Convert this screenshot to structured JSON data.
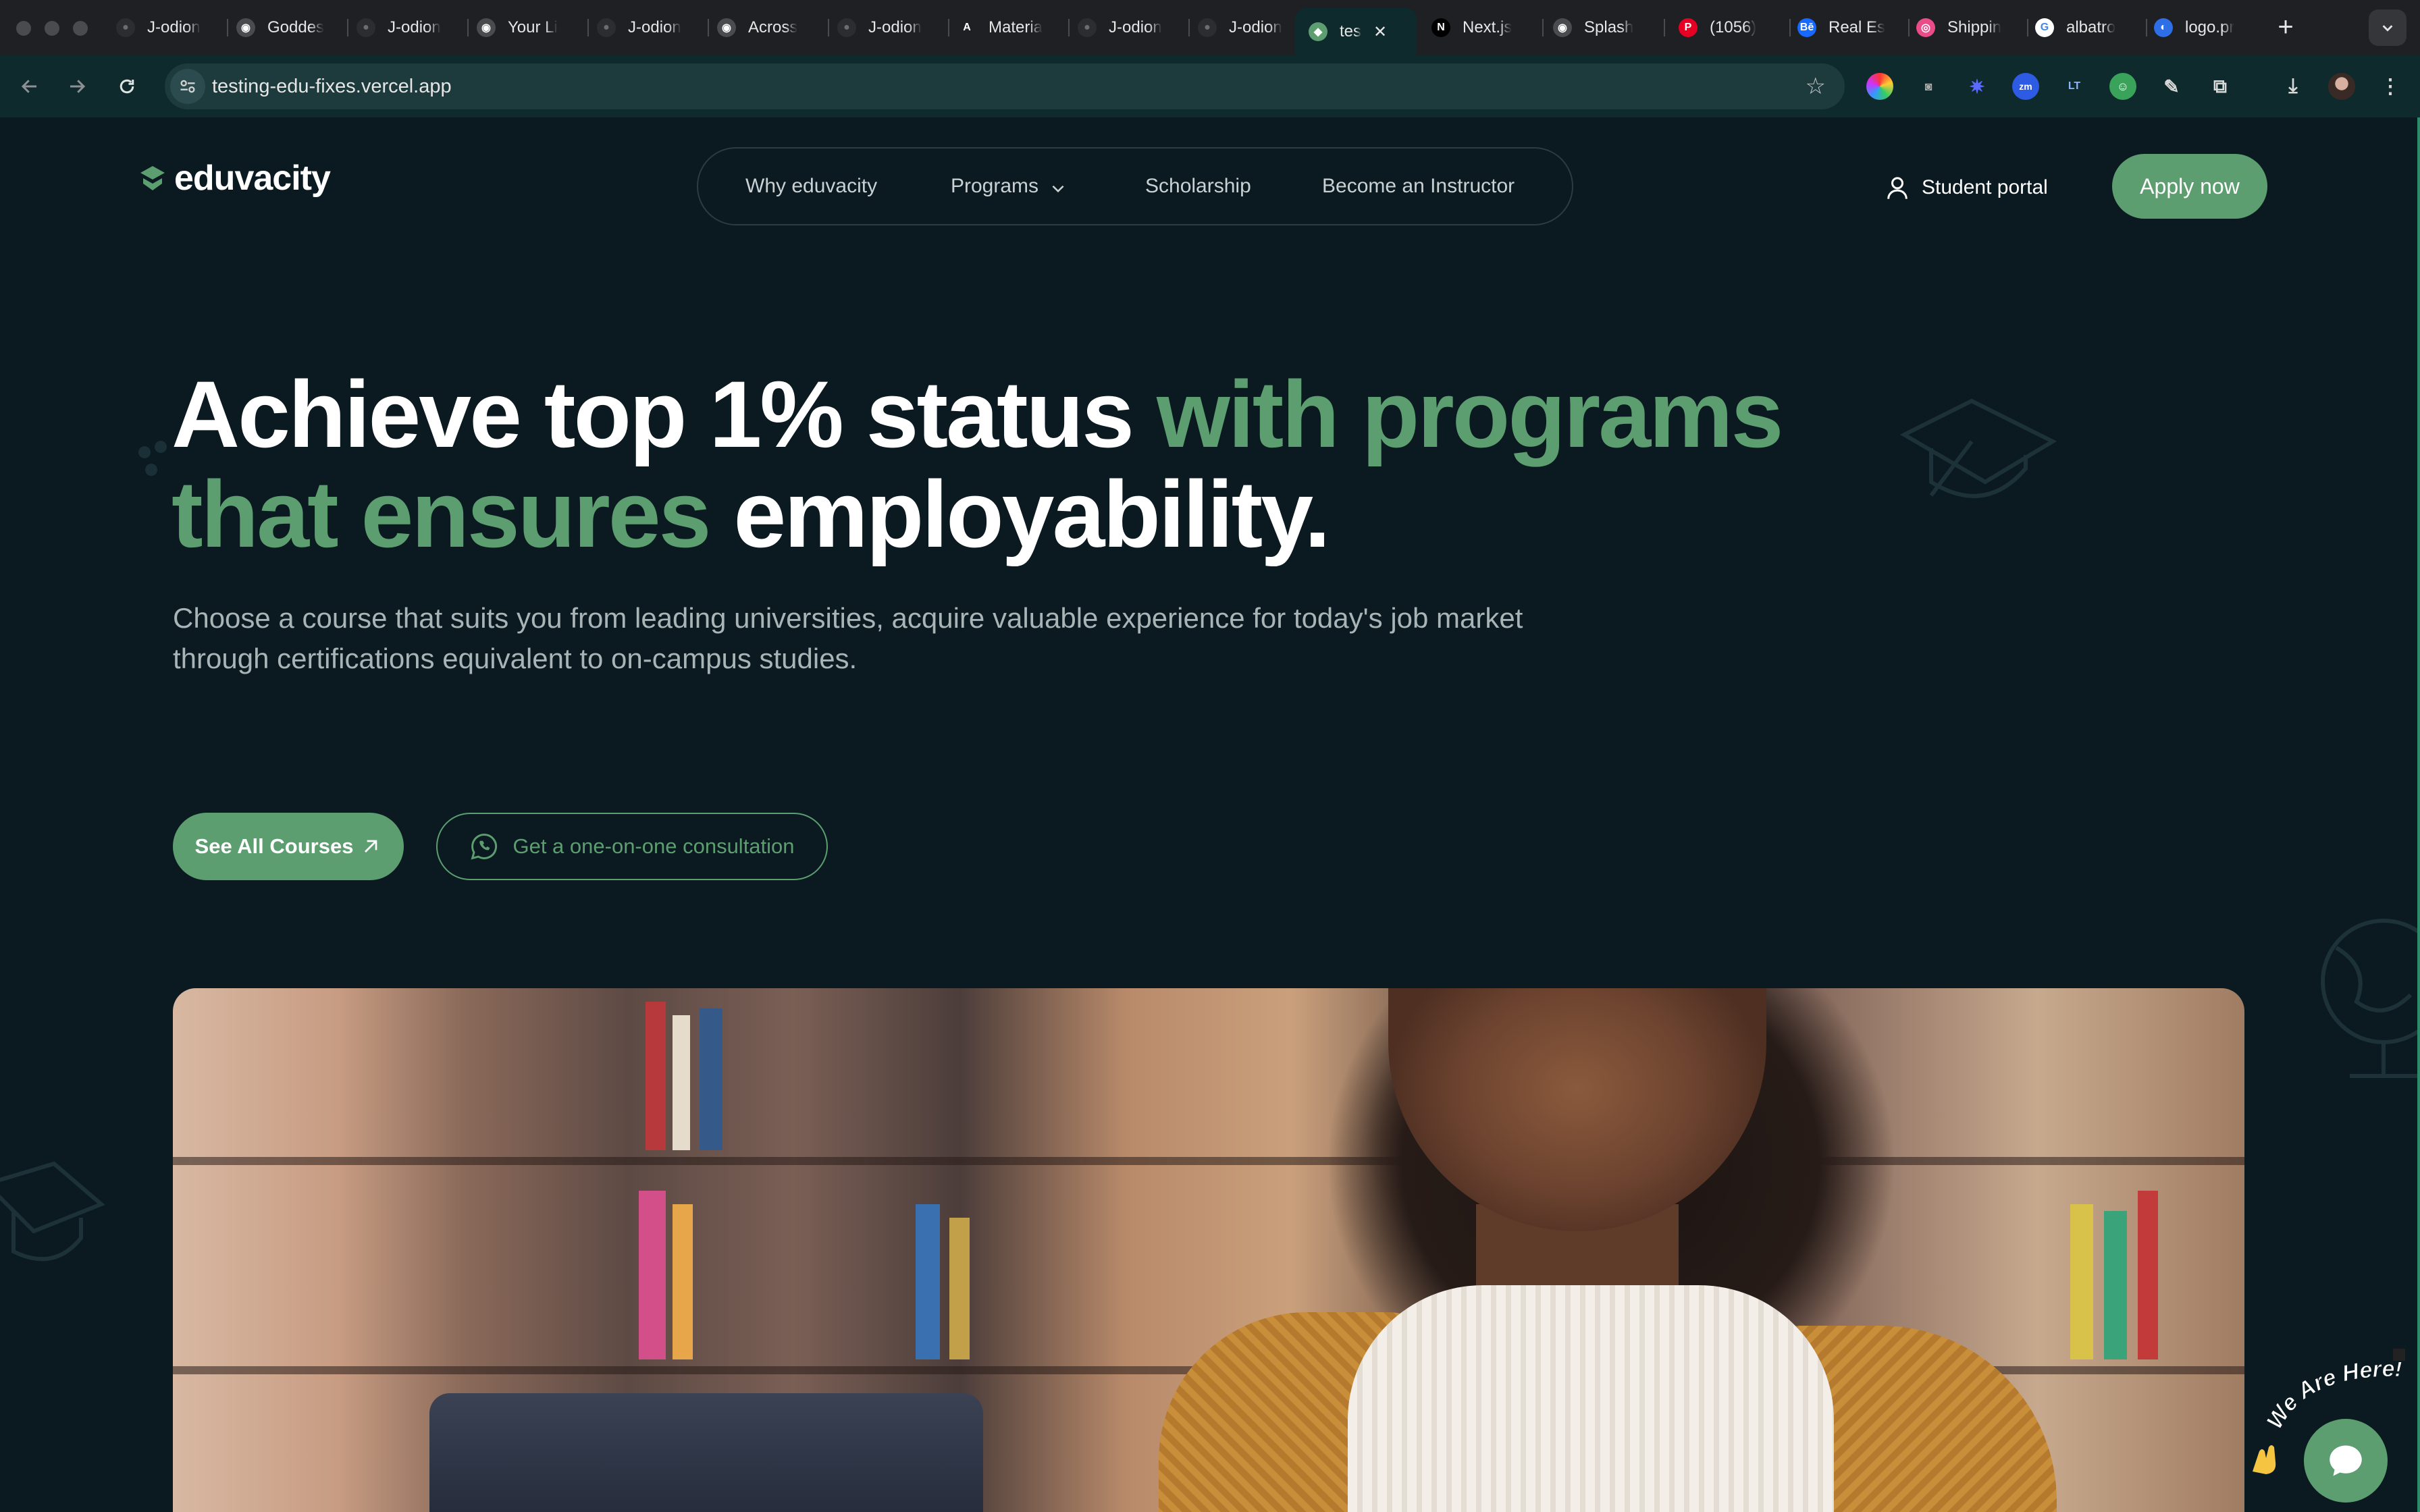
{
  "browser": {
    "tabs": [
      {
        "title": "J-odion",
        "icon": "github-icon",
        "color": "#2b2d31"
      },
      {
        "title": "Goddes",
        "icon": "globe-icon",
        "color": "#4a4b4e"
      },
      {
        "title": "J-odion",
        "icon": "github-icon",
        "color": "#2b2d31"
      },
      {
        "title": "Your Li",
        "icon": "globe-icon",
        "color": "#4a4b4e"
      },
      {
        "title": "J-odion",
        "icon": "github-icon",
        "color": "#2b2d31"
      },
      {
        "title": "Across",
        "icon": "globe-icon",
        "color": "#4a4b4e"
      },
      {
        "title": "J-odion",
        "icon": "github-icon",
        "color": "#2b2d31"
      },
      {
        "title": "Materia",
        "icon": "material-icon",
        "color": "#1f2023"
      },
      {
        "title": "J-odion",
        "icon": "github-icon",
        "color": "#2b2d31"
      },
      {
        "title": "J-odion",
        "icon": "github-icon",
        "color": "#2b2d31"
      },
      {
        "title": "tes",
        "icon": "eduvacity-icon",
        "color": "#5c9e70",
        "active": true
      },
      {
        "title": "Next.js",
        "icon": "nextjs-icon",
        "color": "#000000"
      },
      {
        "title": "Splash",
        "icon": "globe-icon",
        "color": "#4a4b4e"
      },
      {
        "title": "(1056)",
        "icon": "pinterest-icon",
        "color": "#e60023"
      },
      {
        "title": "Real Es",
        "icon": "behance-icon",
        "color": "#1769ff"
      },
      {
        "title": "Shippin",
        "icon": "dribbble-icon",
        "color": "#ea4c89"
      },
      {
        "title": "albatro",
        "icon": "google-icon",
        "color": "#ffffff"
      },
      {
        "title": "logo.pr",
        "icon": "logo-icon",
        "color": "#2e6ee6"
      }
    ],
    "tab_close_glyph": "✕",
    "new_tab_glyph": "+",
    "url": "testing-edu-fixes.vercel.app"
  },
  "site": {
    "brand": "eduvacity",
    "nav": {
      "why": "Why eduvacity",
      "programs": "Programs",
      "scholarship": "Scholarship",
      "instructor": "Become an Instructor"
    },
    "student_portal": "Student portal",
    "apply": "Apply now",
    "hero": {
      "title_white_1": "Achieve top 1% status ",
      "title_green_1": "with programs that ensures",
      "title_white_2": " employability.",
      "subtitle": "Choose a course that suits you from leading universities, acquire valuable experience for today's job market through certifications equivalent to on-campus studies."
    },
    "cta_primary": "See All Courses",
    "cta_secondary": "Get a one-on-one consultation",
    "chat_label": "We Are Here!"
  },
  "colors": {
    "brand_green": "#5c9e70",
    "page_bg": "#0a1a20",
    "chrome_bg": "#1f2023",
    "toolbar_bg": "#0f2a2c"
  }
}
